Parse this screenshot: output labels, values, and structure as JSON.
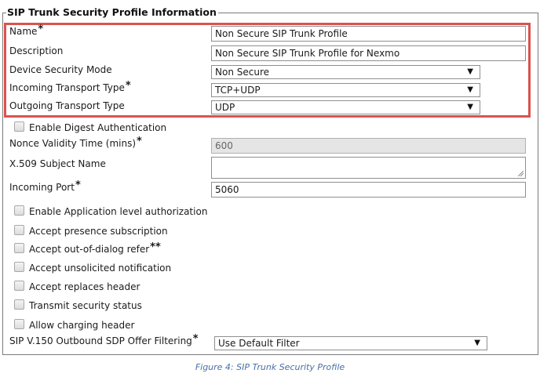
{
  "panel": {
    "title": "SIP Trunk Security Profile Information"
  },
  "fields": {
    "name": {
      "label": "Name",
      "required": "*",
      "value": "Non Secure SIP Trunk Profile"
    },
    "description": {
      "label": "Description",
      "value": "Non Secure SIP Trunk Profile for Nexmo"
    },
    "device_security_mode": {
      "label": "Device Security Mode",
      "value": "Non Secure"
    },
    "incoming_transport_type": {
      "label": "Incoming Transport Type",
      "required": "*",
      "value": "TCP+UDP"
    },
    "outgoing_transport_type": {
      "label": "Outgoing Transport Type",
      "value": "UDP"
    },
    "nonce_validity": {
      "label": "Nonce Validity Time (mins)",
      "required": "*",
      "value": "600"
    },
    "x509_subject": {
      "label": "X.509 Subject Name",
      "value": ""
    },
    "incoming_port": {
      "label": "Incoming Port",
      "required": "*",
      "value": "5060"
    },
    "sdp_filtering": {
      "label": "SIP V.150 Outbound SDP Offer Filtering",
      "required": "*",
      "value": "Use Default Filter"
    }
  },
  "checkboxes": {
    "digest_auth": {
      "label": "Enable Digest Authentication",
      "checked": false
    },
    "app_level_auth": {
      "label": "Enable Application level authorization",
      "checked": false
    },
    "presence_subscription": {
      "label": "Accept presence subscription",
      "checked": false
    },
    "out_of_dialog_refer": {
      "label": "Accept out-of-dialog refer",
      "suffix": "**",
      "checked": false
    },
    "unsolicited_notification": {
      "label": "Accept unsolicited notification",
      "checked": false
    },
    "replaces_header": {
      "label": "Accept replaces header",
      "checked": false
    },
    "security_status": {
      "label": "Transmit security status",
      "checked": false
    },
    "charging_header": {
      "label": "Allow charging header",
      "checked": false
    }
  },
  "icons": {
    "dropdown": "dropdown-arrow-icon",
    "resize": "resize-grip-icon"
  },
  "colors": {
    "highlight_border": "#d9534f",
    "caption": "#4a6fa5"
  },
  "caption": "Figure 4: SIP Trunk Security Profile"
}
